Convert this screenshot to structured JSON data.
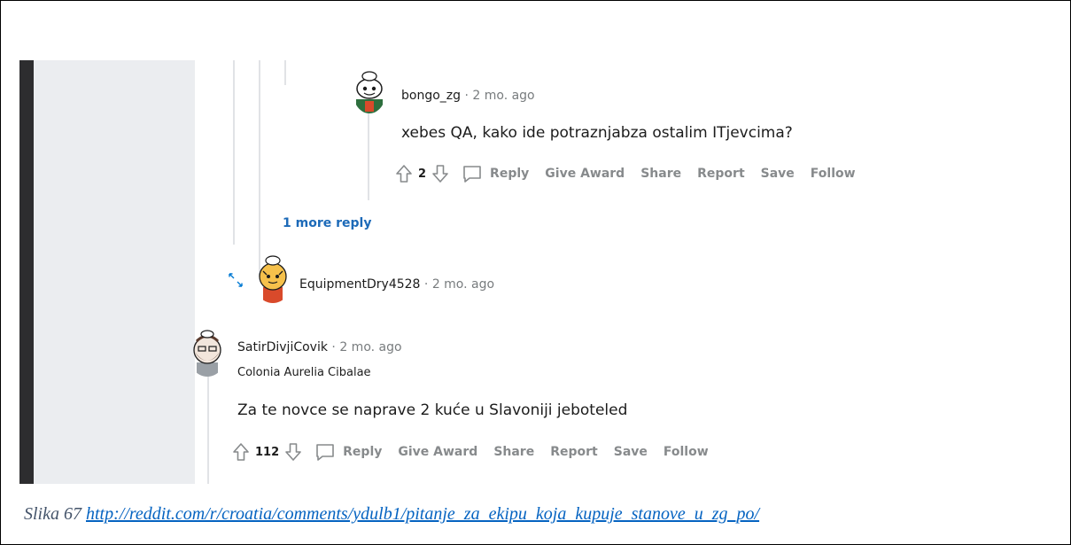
{
  "comments": [
    {
      "username": "bongo_zg",
      "separator": "·",
      "time": "2 mo. ago",
      "body": "xebes QA, kako ide potraznjabza ostalim ITjevcima?",
      "score": "2"
    },
    {
      "username": "EquipmentDry4528",
      "separator": "·",
      "time": "2 mo. ago"
    },
    {
      "username": "SatirDivjiCovik",
      "separator": "·",
      "time": "2 mo. ago",
      "flair": "Colonia Aurelia Cibalae",
      "body": "Za te novce se naprave 2 kuće u Slavoniji jeboteled",
      "score": "112"
    }
  ],
  "more_replies": "1 more reply",
  "actions": {
    "reply": "Reply",
    "give_award": "Give Award",
    "share": "Share",
    "report": "Report",
    "save": "Save",
    "follow": "Follow"
  },
  "caption": {
    "label": "Slika 67",
    "url": "http://reddit.com/r/croatia/comments/ydulb1/pitanje_za_ekipu_koja_kupuje_stanove_u_zg_po/"
  },
  "colors": {
    "link": "#0563c1",
    "caption_text": "#44546a",
    "action_gray": "#878a8c",
    "more_reply_blue": "#1c6ab8"
  },
  "icons": [
    "upvote-icon",
    "downvote-icon",
    "comment-bubble-icon",
    "expand-icon",
    "avatar-snoo"
  ]
}
